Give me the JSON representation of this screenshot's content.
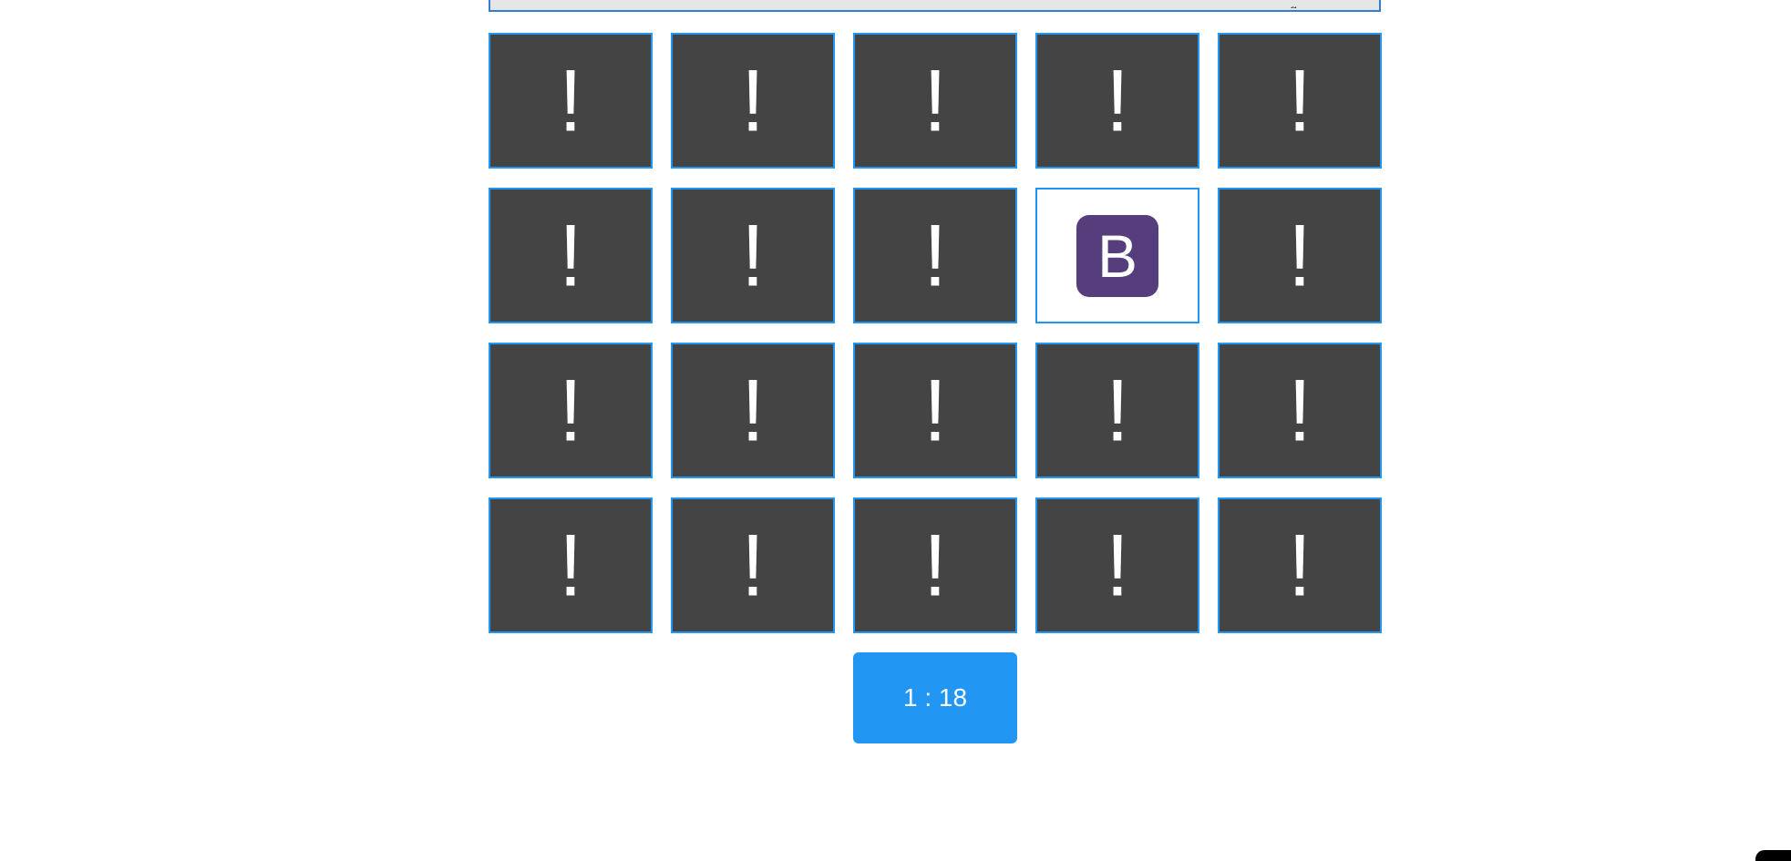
{
  "top_bar": {
    "text": "g"
  },
  "board": {
    "hidden_symbol": "!",
    "cards": [
      {
        "state": "hidden",
        "icon": "exclamation-icon"
      },
      {
        "state": "hidden",
        "icon": "exclamation-icon"
      },
      {
        "state": "hidden",
        "icon": "exclamation-icon"
      },
      {
        "state": "hidden",
        "icon": "exclamation-icon"
      },
      {
        "state": "hidden",
        "icon": "exclamation-icon"
      },
      {
        "state": "hidden",
        "icon": "exclamation-icon"
      },
      {
        "state": "hidden",
        "icon": "exclamation-icon"
      },
      {
        "state": "hidden",
        "icon": "exclamation-icon"
      },
      {
        "state": "revealed",
        "icon": "bootstrap-logo-icon",
        "letter": "B",
        "color": "#563d7c"
      },
      {
        "state": "hidden",
        "icon": "exclamation-icon"
      },
      {
        "state": "hidden",
        "icon": "exclamation-icon"
      },
      {
        "state": "hidden",
        "icon": "exclamation-icon"
      },
      {
        "state": "hidden",
        "icon": "exclamation-icon"
      },
      {
        "state": "hidden",
        "icon": "exclamation-icon"
      },
      {
        "state": "hidden",
        "icon": "exclamation-icon"
      },
      {
        "state": "hidden",
        "icon": "exclamation-icon"
      },
      {
        "state": "hidden",
        "icon": "exclamation-icon"
      },
      {
        "state": "hidden",
        "icon": "exclamation-icon"
      },
      {
        "state": "hidden",
        "icon": "exclamation-icon"
      },
      {
        "state": "hidden",
        "icon": "exclamation-icon"
      }
    ]
  },
  "timer": {
    "label": "1 : 18"
  },
  "colors": {
    "card_back": "#444444",
    "card_border": "#2196f3",
    "timer_bg": "#2196f3",
    "logo_purple": "#563d7c"
  }
}
